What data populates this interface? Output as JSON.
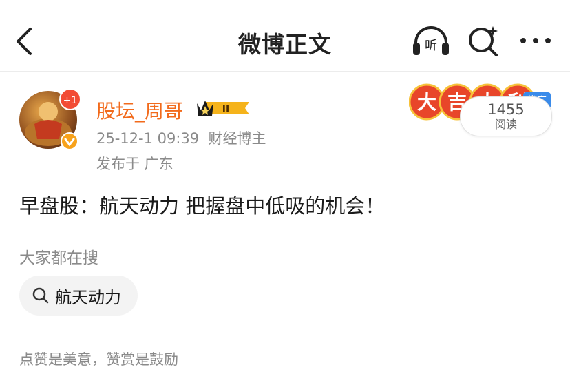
{
  "header": {
    "title": "微博正文",
    "listen_label": "听"
  },
  "post": {
    "author": "股坛_周哥",
    "avatar_badge": "+1",
    "level_badge": "II",
    "timestamp": "25-12-1 09:39",
    "author_tag": "财经博主",
    "location": "发布于 广东",
    "content": "早盘股：航天动力 把握盘中低吸的机会！",
    "read_count": "1455",
    "read_label": "阅读",
    "promo_tag": "推广",
    "promo_chars": [
      "大",
      "吉",
      "大",
      "利"
    ]
  },
  "trending": {
    "title": "大家都在搜",
    "query": "航天动力"
  },
  "footer": {
    "text": "点赞是美意，赞赏是鼓励"
  },
  "colors": {
    "accent": "#f26a1b",
    "muted": "#8a8a8a",
    "promo_blue": "#3a8bea"
  }
}
